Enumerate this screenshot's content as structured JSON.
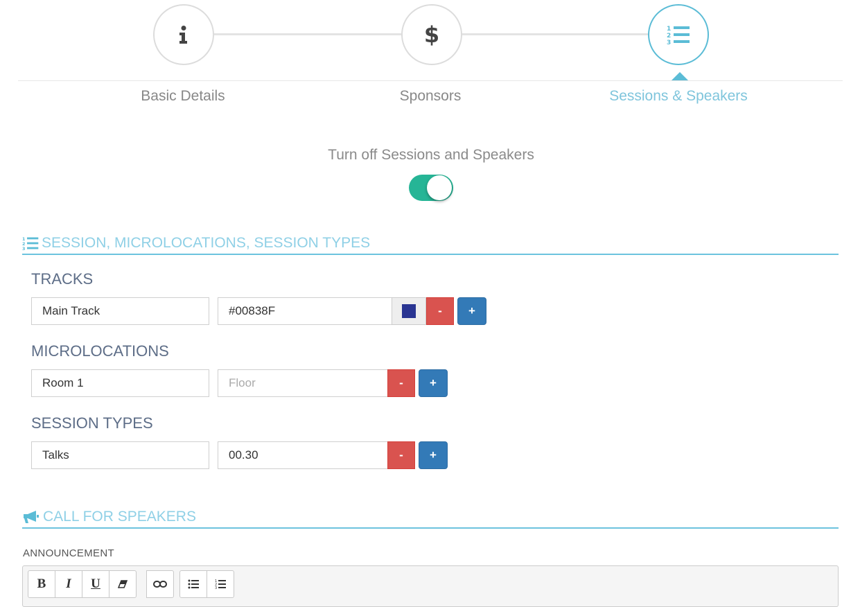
{
  "stepper": {
    "steps": [
      {
        "label": "Basic Details",
        "icon": "info-icon"
      },
      {
        "label": "Sponsors",
        "icon": "dollar-icon"
      },
      {
        "label": "Sessions & Speakers",
        "icon": "ordered-list-icon",
        "active": true
      }
    ]
  },
  "toggle": {
    "title": "Turn off Sessions and Speakers",
    "on": true
  },
  "sessions_section": {
    "title": "SESSION, MICROLOCATIONS, SESSION TYPES",
    "tracks": {
      "heading": "TRACKS",
      "name": "Main Track",
      "color": "#00838F",
      "swatch_color": "#2a3592"
    },
    "microlocations": {
      "heading": "MICROLOCATIONS",
      "name": "Room 1",
      "floor_placeholder": "Floor"
    },
    "session_types": {
      "heading": "SESSION TYPES",
      "name": "Talks",
      "length": "00.30"
    },
    "remove_label": "-",
    "add_label": "+"
  },
  "speakers_section": {
    "title": "CALL FOR SPEAKERS",
    "announcement_label": "ANNOUNCEMENT",
    "toolbar": {
      "bold": "B",
      "italic": "I",
      "underline": "U"
    }
  },
  "colors": {
    "accent": "#5bbcd6",
    "toggle": "#26b596",
    "danger": "#d9534f",
    "primary": "#337ab7"
  }
}
